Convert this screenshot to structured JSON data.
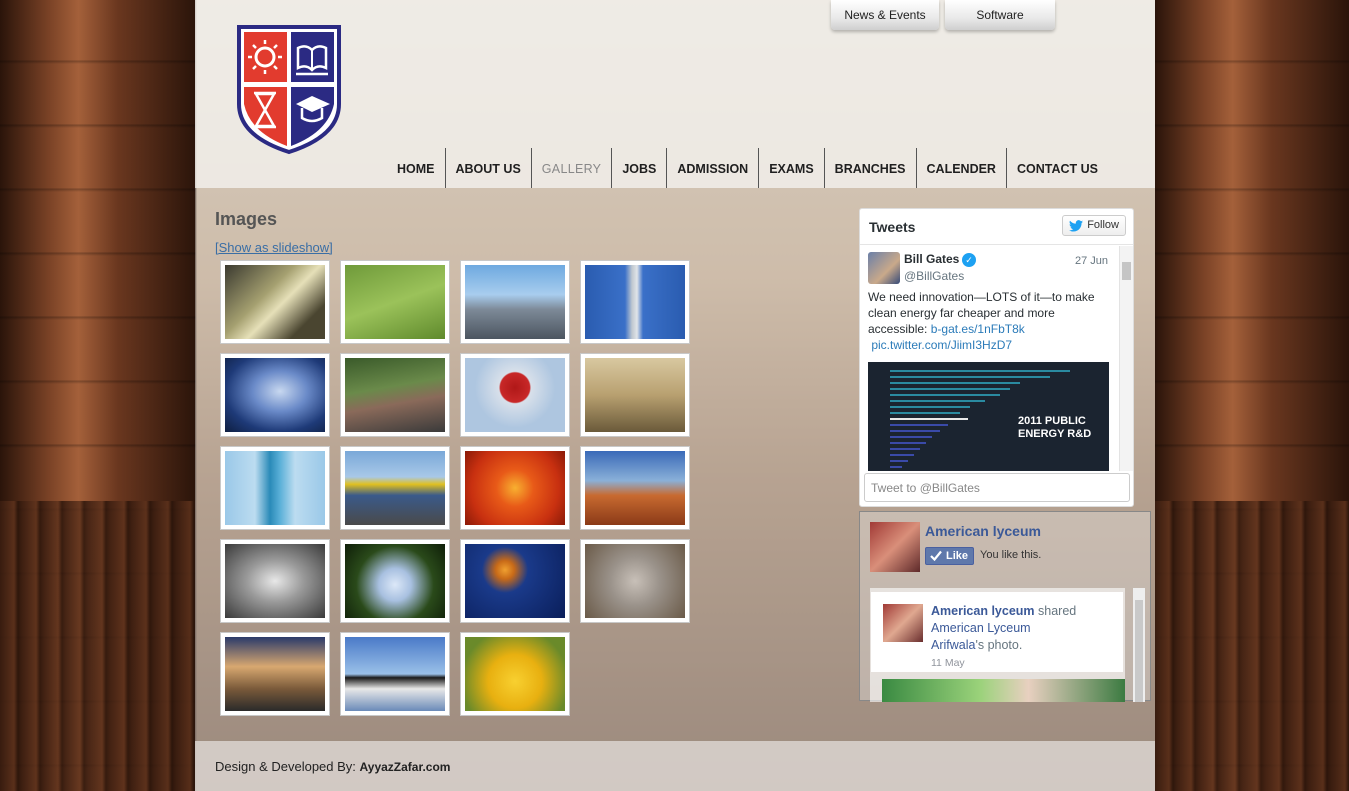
{
  "top_tabs": {
    "news": "News & Events",
    "software": "Software"
  },
  "nav": {
    "items": [
      {
        "label": "HOME"
      },
      {
        "label": "ABOUT US"
      },
      {
        "label": "GALLERY"
      },
      {
        "label": "JOBS"
      },
      {
        "label": "ADMISSION"
      },
      {
        "label": "EXAMS"
      },
      {
        "label": "BRANCHES"
      },
      {
        "label": "CALENDER"
      },
      {
        "label": "CONTACT US"
      }
    ],
    "active": "GALLERY"
  },
  "gallery": {
    "title": "Images",
    "slideshow_link": "[Show as slideshow]"
  },
  "twitter": {
    "title": "Tweets",
    "follow_label": "Follow",
    "tweet": {
      "name": "Bill Gates",
      "handle": "@BillGates",
      "date": "27 Jun",
      "text": "We need innovation—LOTS of it—to make clean energy far cheaper and more accessible:",
      "link1": "b-gat.es/1nFbT8k",
      "link2": "pic.twitter.com/JiimI3HzD7",
      "image_title_line1": "2011 PUBLIC",
      "image_title_line2": "ENERGY R&D"
    },
    "input_placeholder": "Tweet to @BillGates"
  },
  "facebook": {
    "page_name": "American lyceum",
    "like_label": "Like",
    "you_like": "You like this.",
    "post": {
      "author": "American lyceum",
      "action": "shared",
      "line2": "American Lyceum",
      "line3_name": "Arifwala",
      "line3_rest": "'s photo.",
      "date": "11 May"
    }
  },
  "footer": {
    "prefix": "Design & Developed By:",
    "developer": "AyyazZafar.com"
  },
  "colors": {
    "link": "#3a6ea5",
    "twitter_blue": "#1da1f2",
    "facebook_blue": "#3b5998",
    "shield_red": "#e23b2e",
    "shield_navy": "#2b2a83"
  }
}
